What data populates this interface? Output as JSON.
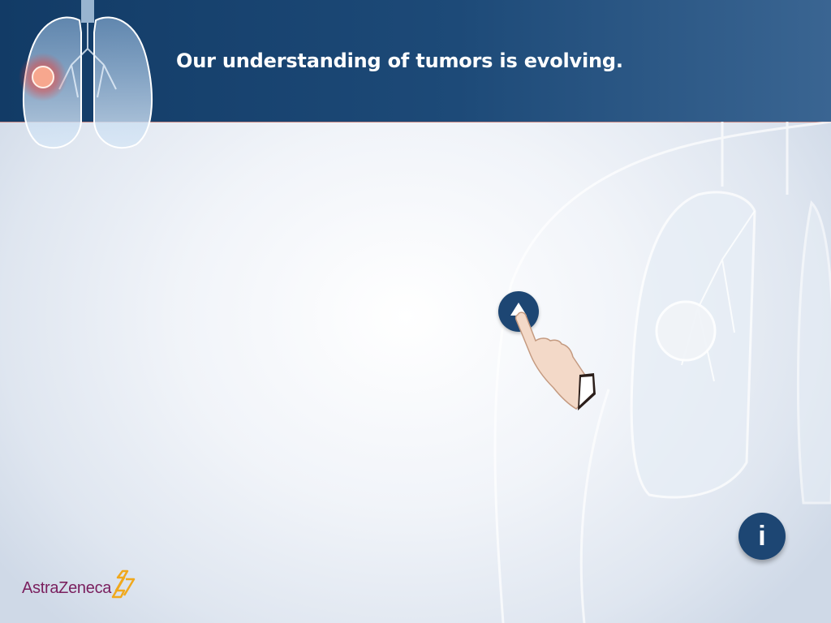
{
  "header": {
    "title": "Our understanding of tumors is evolving."
  },
  "icons": {
    "lung": "lung-tumor-icon",
    "tap_target": "triangle-up-icon",
    "hand": "pointing-hand-icon",
    "info": "info-icon",
    "logo_mark": "astrazeneca-symbol-icon"
  },
  "info_button": {
    "glyph": "i"
  },
  "footer": {
    "brand": "AstraZeneca"
  },
  "colors": {
    "header_dark": "#123b66",
    "header_light": "#3a6592",
    "button": "#1d4673",
    "brand_text": "#7a1f5e",
    "brand_mark": "#f0a81c"
  }
}
